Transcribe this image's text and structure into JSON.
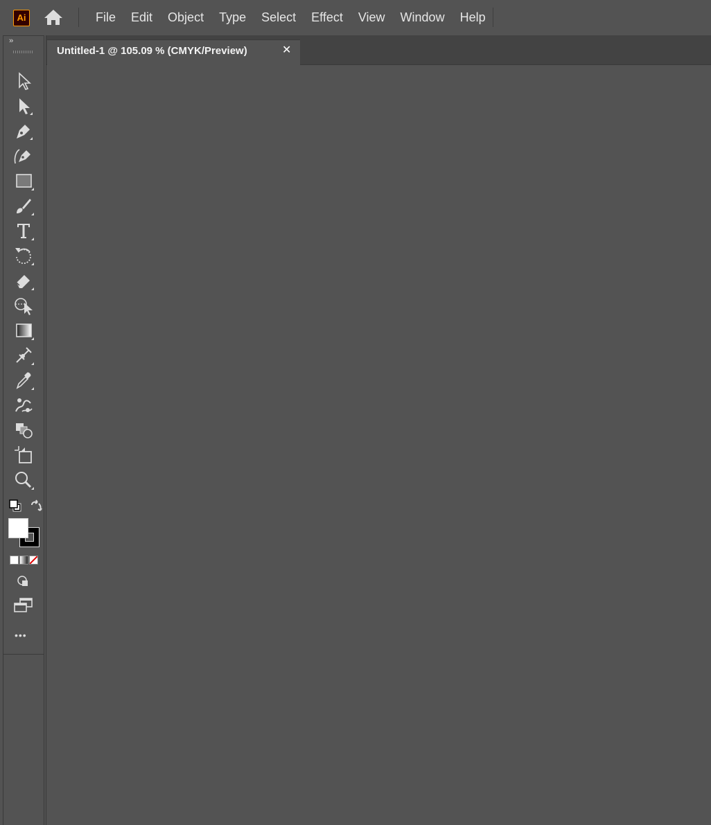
{
  "app": {
    "logo_text": "Ai",
    "accent": "#ff9a00"
  },
  "menu": {
    "items": [
      "File",
      "Edit",
      "Object",
      "Type",
      "Select",
      "Effect",
      "View",
      "Window",
      "Help"
    ]
  },
  "toolbar": {
    "collapse_label": "››",
    "tools": [
      "selection-tool-icon",
      "direct-selection-tool-icon",
      "pen-tool-icon",
      "curvature-tool-icon",
      "rectangle-tool-icon",
      "paintbrush-tool-icon",
      "type-tool-icon",
      "rotate-tool-icon",
      "eraser-tool-icon",
      "shape-builder-tool-icon",
      "gradient-tool-icon",
      "width-tool-icon",
      "eyedropper-tool-icon",
      "symbol-sprayer-tool-icon",
      "live-paint-tool-icon",
      "artboard-tool-icon",
      "zoom-tool-icon"
    ],
    "fill_color": "#ffffff",
    "stroke_color": "#000000",
    "more_label": "•••"
  },
  "document": {
    "tab_title": "Untitled-1 @ 105.09 % (CMYK/Preview)",
    "close_label": "✕"
  }
}
